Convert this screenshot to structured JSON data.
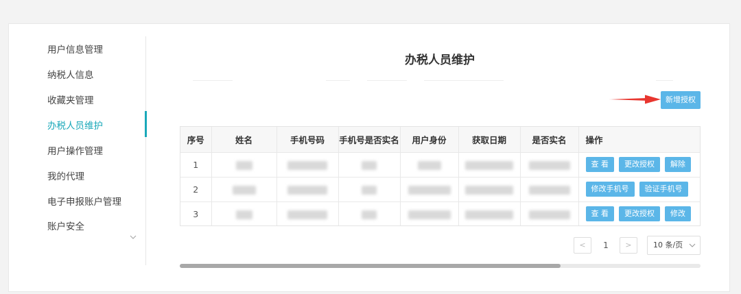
{
  "sidebar": {
    "items": [
      {
        "label": "用户信息管理"
      },
      {
        "label": "纳税人信息"
      },
      {
        "label": "收藏夹管理"
      },
      {
        "label": "办税人员维护"
      },
      {
        "label": "用户操作管理"
      },
      {
        "label": "我的代理"
      },
      {
        "label": "电子申报账户管理"
      },
      {
        "label": "账户安全"
      }
    ],
    "active_index": 3
  },
  "main": {
    "title": "办税人员维护",
    "new_button_label": "新增授权"
  },
  "table": {
    "headers": [
      "序号",
      "姓名",
      "手机号码",
      "手机号是否实名",
      "用户身份",
      "获取日期",
      "是否实名",
      "操作"
    ],
    "rows": [
      {
        "index": "1",
        "ops": [
          "查 看",
          "更改授权",
          "解除"
        ]
      },
      {
        "index": "2",
        "ops": [
          "修改手机号",
          "验证手机号"
        ]
      },
      {
        "index": "3",
        "ops": [
          "查 看",
          "更改授权",
          "修改"
        ]
      }
    ]
  },
  "pagination": {
    "prev": "<",
    "current_page": "1",
    "next": ">",
    "page_size": "10 条/页"
  },
  "colors": {
    "accent": "#19a8b9",
    "button": "#5bb6e8",
    "arrow": "#e8362f"
  }
}
